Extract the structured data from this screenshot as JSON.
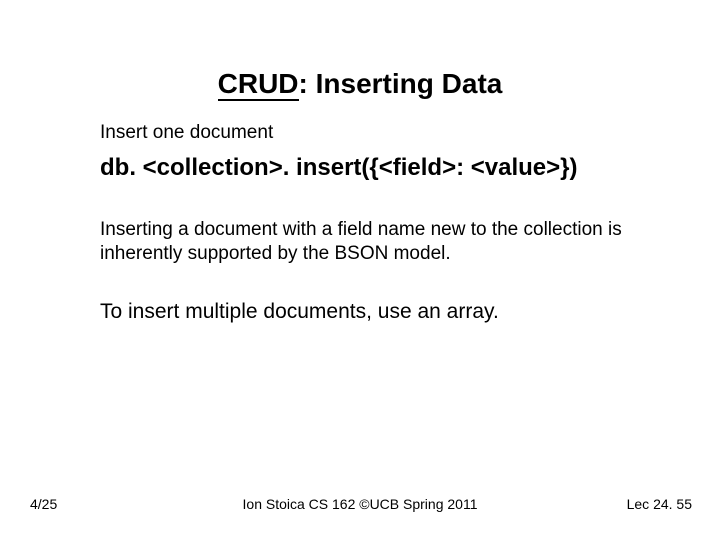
{
  "slide": {
    "title_acronym": "CRUD",
    "title_rest": ": Inserting Data",
    "intro": "Insert one document",
    "code": "db. <collection>. insert({<field>: <value>})",
    "explanation": "Inserting a document with a field name new to the collection is inherently supported by the BSON model.",
    "instruction": "To insert multiple documents, use an array."
  },
  "footer": {
    "date": "4/25",
    "credit": "Ion Stoica CS 162 ©UCB Spring 2011",
    "lecture": "Lec 24. 55"
  }
}
